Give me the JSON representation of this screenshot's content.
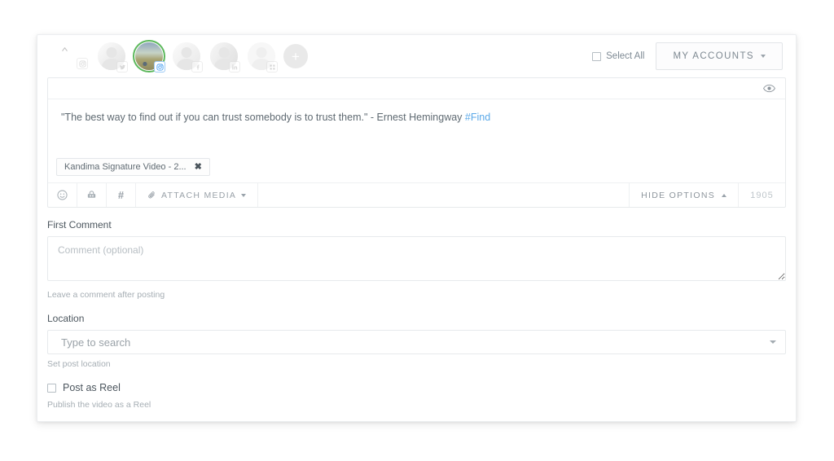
{
  "account_bar": {
    "scroll_left_icon": "chevron-left-icon",
    "accounts": [
      {
        "id": "acct-twitter",
        "network": "twitter",
        "badge_icon": "twitter-icon",
        "selected": false,
        "style": "ph-a"
      },
      {
        "id": "acct-instagram",
        "network": "instagram",
        "badge_icon": "instagram-icon",
        "selected": true,
        "style": "photo"
      },
      {
        "id": "acct-facebook",
        "network": "facebook",
        "badge_icon": "facebook-icon",
        "selected": false,
        "style": "ph-b"
      },
      {
        "id": "acct-linkedin",
        "network": "linkedin",
        "badge_icon": "linkedin-icon",
        "selected": false,
        "style": "ph-c"
      },
      {
        "id": "acct-other",
        "network": "other",
        "badge_icon": "grid-icon",
        "selected": false,
        "style": "ph-blank"
      }
    ],
    "add_account_label": "+",
    "add_account_icon": "plus-circle-icon",
    "select_all_label": "Select All",
    "select_all_checked": false,
    "my_accounts_label": "MY ACCOUNTS",
    "my_accounts_caret_icon": "chevron-down-icon"
  },
  "composer": {
    "preview_icon": "eye-icon",
    "text": "\"The best way to find out if you can trust somebody is to trust them.\" - Ernest Hemingway ",
    "hashtag": "#Find",
    "hashtag_color": "#5ba9e8",
    "media_chip": {
      "label": "Kandima Signature Video - 2...",
      "remove_icon": "close-icon",
      "remove_label": "✖"
    },
    "toolbar": {
      "emoji_icon": "emoji-smiley-icon",
      "emoji_glyph": "☺",
      "link_icon": "link-shortener-icon",
      "hashtag_icon": "hashtag-icon",
      "hashtag_glyph": "#",
      "attach_media_label": "ATTACH MEDIA",
      "attach_media_icon": "paperclip-icon",
      "attach_media_caret_icon": "caret-down-icon",
      "hide_options_label": "HIDE OPTIONS",
      "hide_options_caret_icon": "caret-up-icon",
      "character_count": "1905"
    }
  },
  "options": {
    "first_comment": {
      "label": "First Comment",
      "placeholder": "Comment (optional)",
      "value": "",
      "helper": "Leave a comment after posting"
    },
    "location": {
      "label": "Location",
      "placeholder": "Type to search",
      "value": "",
      "helper": "Set post location",
      "caret_icon": "caret-down-icon"
    },
    "post_as_reel": {
      "label": "Post as Reel",
      "checked": false,
      "helper": "Publish the video as a Reel"
    }
  }
}
